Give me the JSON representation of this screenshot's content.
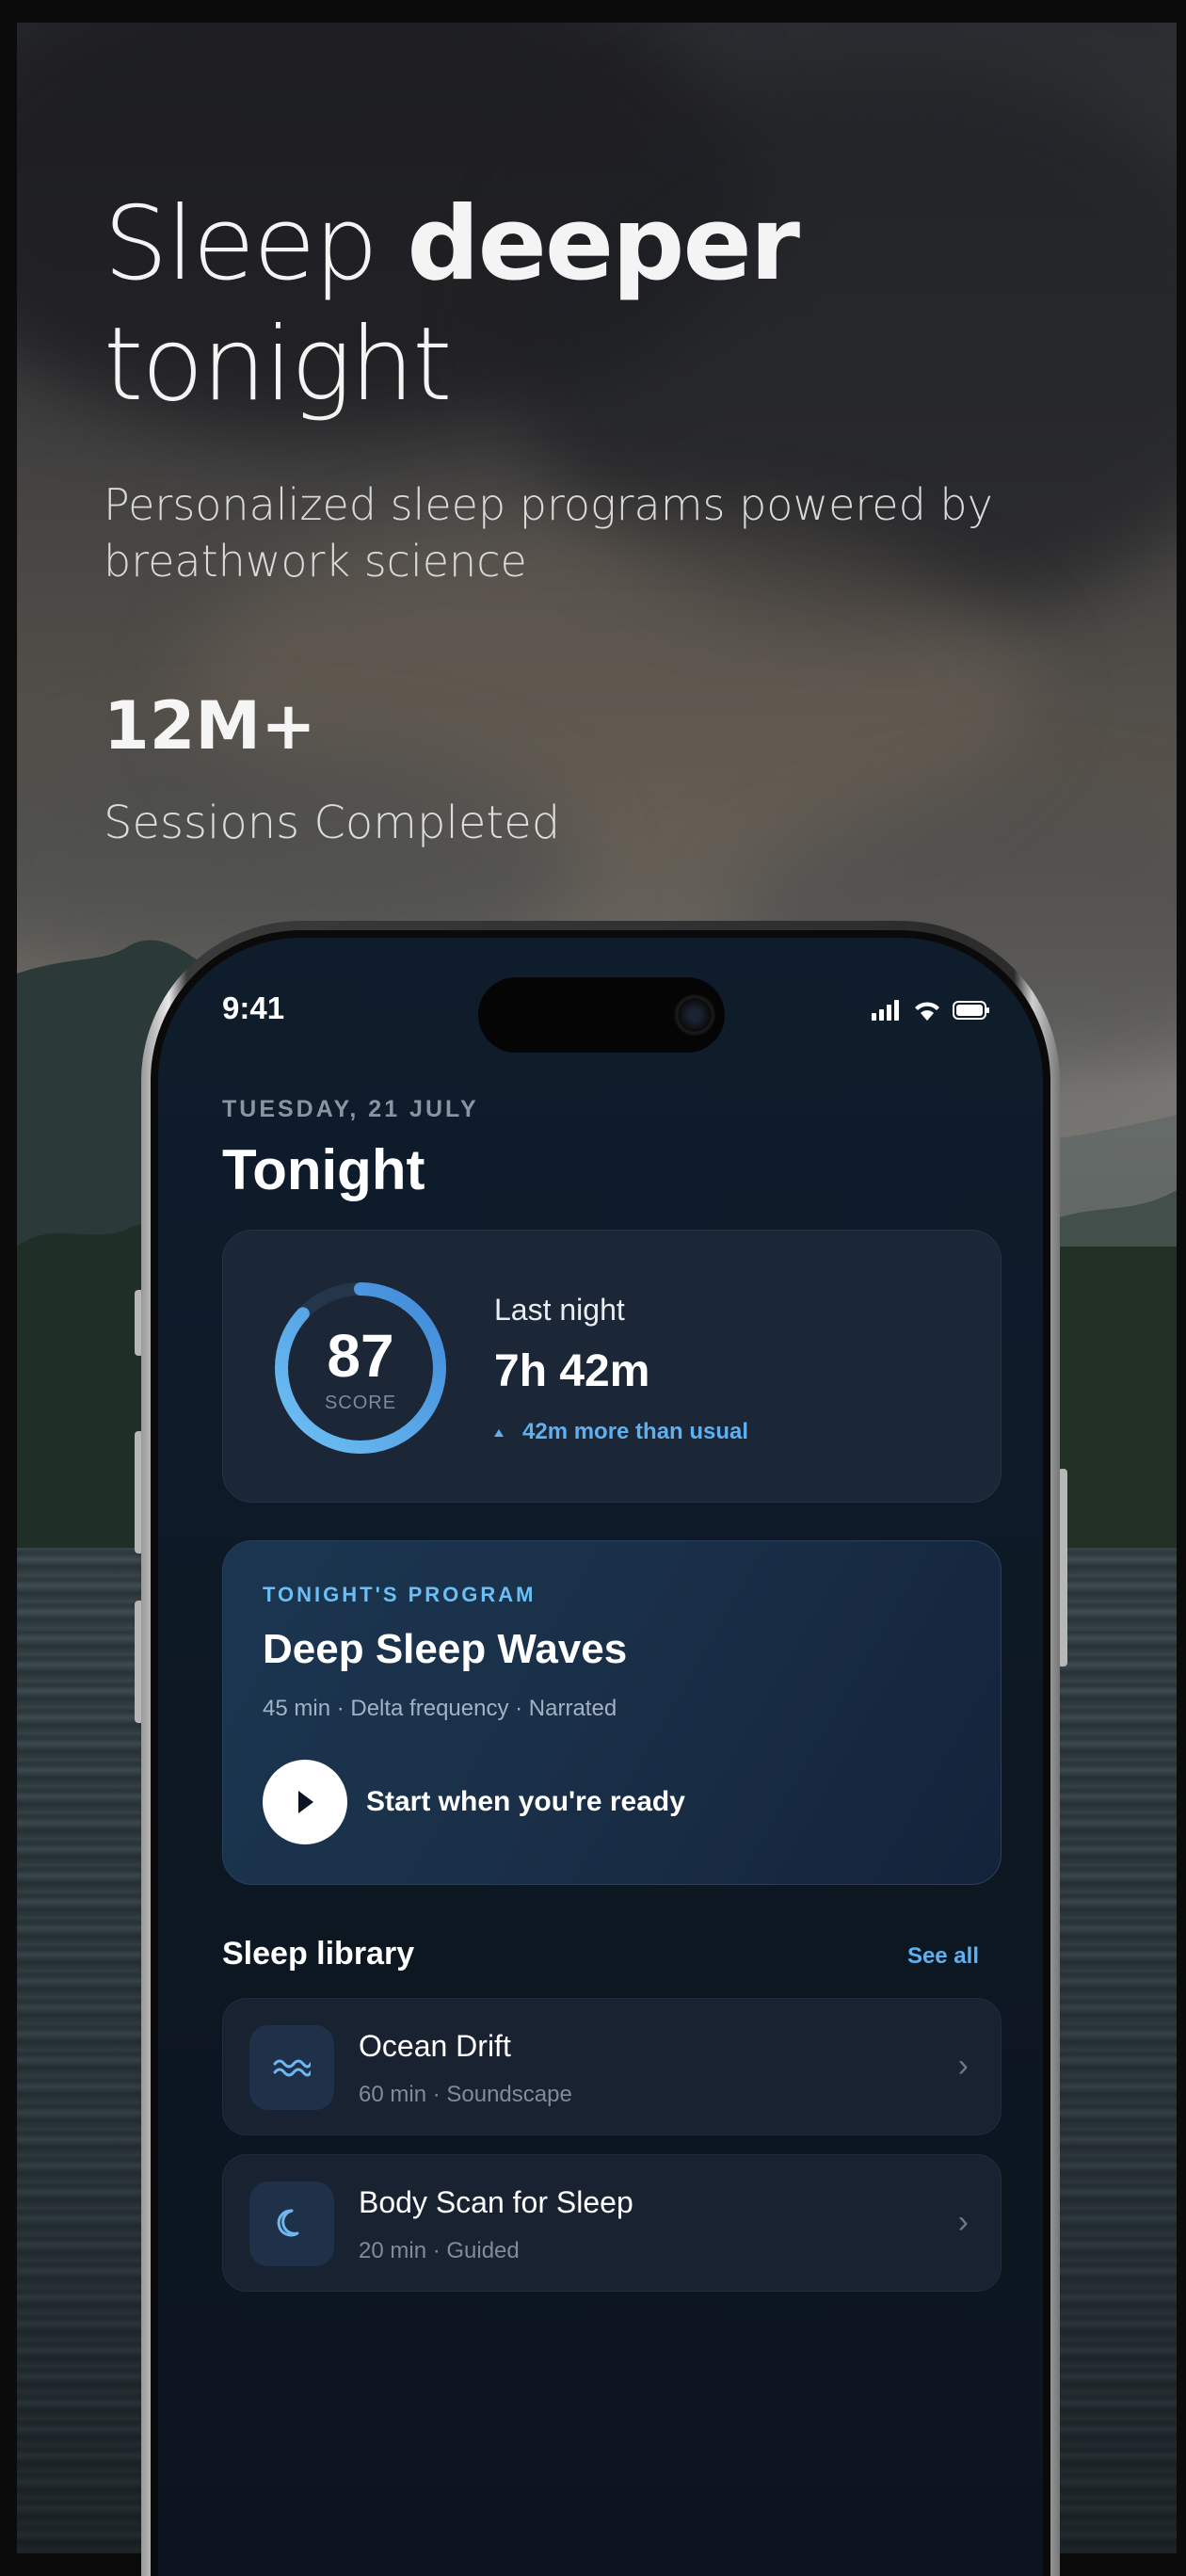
{
  "hero": {
    "title_light": "Sleep ",
    "title_bold": "deeper",
    "title_line2": "tonight",
    "subtitle": "Personalized sleep programs powered by breathwork science",
    "stat_value": "12M+",
    "stat_label": "Sessions Completed"
  },
  "status_bar": {
    "time": "9:41"
  },
  "screen": {
    "date": "TUESDAY, 21 JULY",
    "title": "Tonight"
  },
  "score_card": {
    "score": "87",
    "score_caption": "SCORE",
    "score_fraction": 0.87,
    "last_label": "Last night",
    "last_value": "7h 42m",
    "delta": "42m more than usual"
  },
  "program": {
    "eyebrow": "TONIGHT'S PROGRAM",
    "title": "Deep Sleep Waves",
    "meta": "45 min · Delta frequency · Narrated",
    "cta": "Start when you're ready"
  },
  "library": {
    "title": "Sleep library",
    "see_all": "See all",
    "items": [
      {
        "name": "Ocean Drift",
        "meta": "60 min · Soundscape",
        "icon": "waves-icon"
      },
      {
        "name": "Body Scan for Sleep",
        "meta": "20 min · Guided",
        "icon": "moon-icon"
      }
    ]
  },
  "colors": {
    "accent": "#5fb0f0",
    "card": "#1b2636",
    "screen_bg": "#0e1a28"
  }
}
